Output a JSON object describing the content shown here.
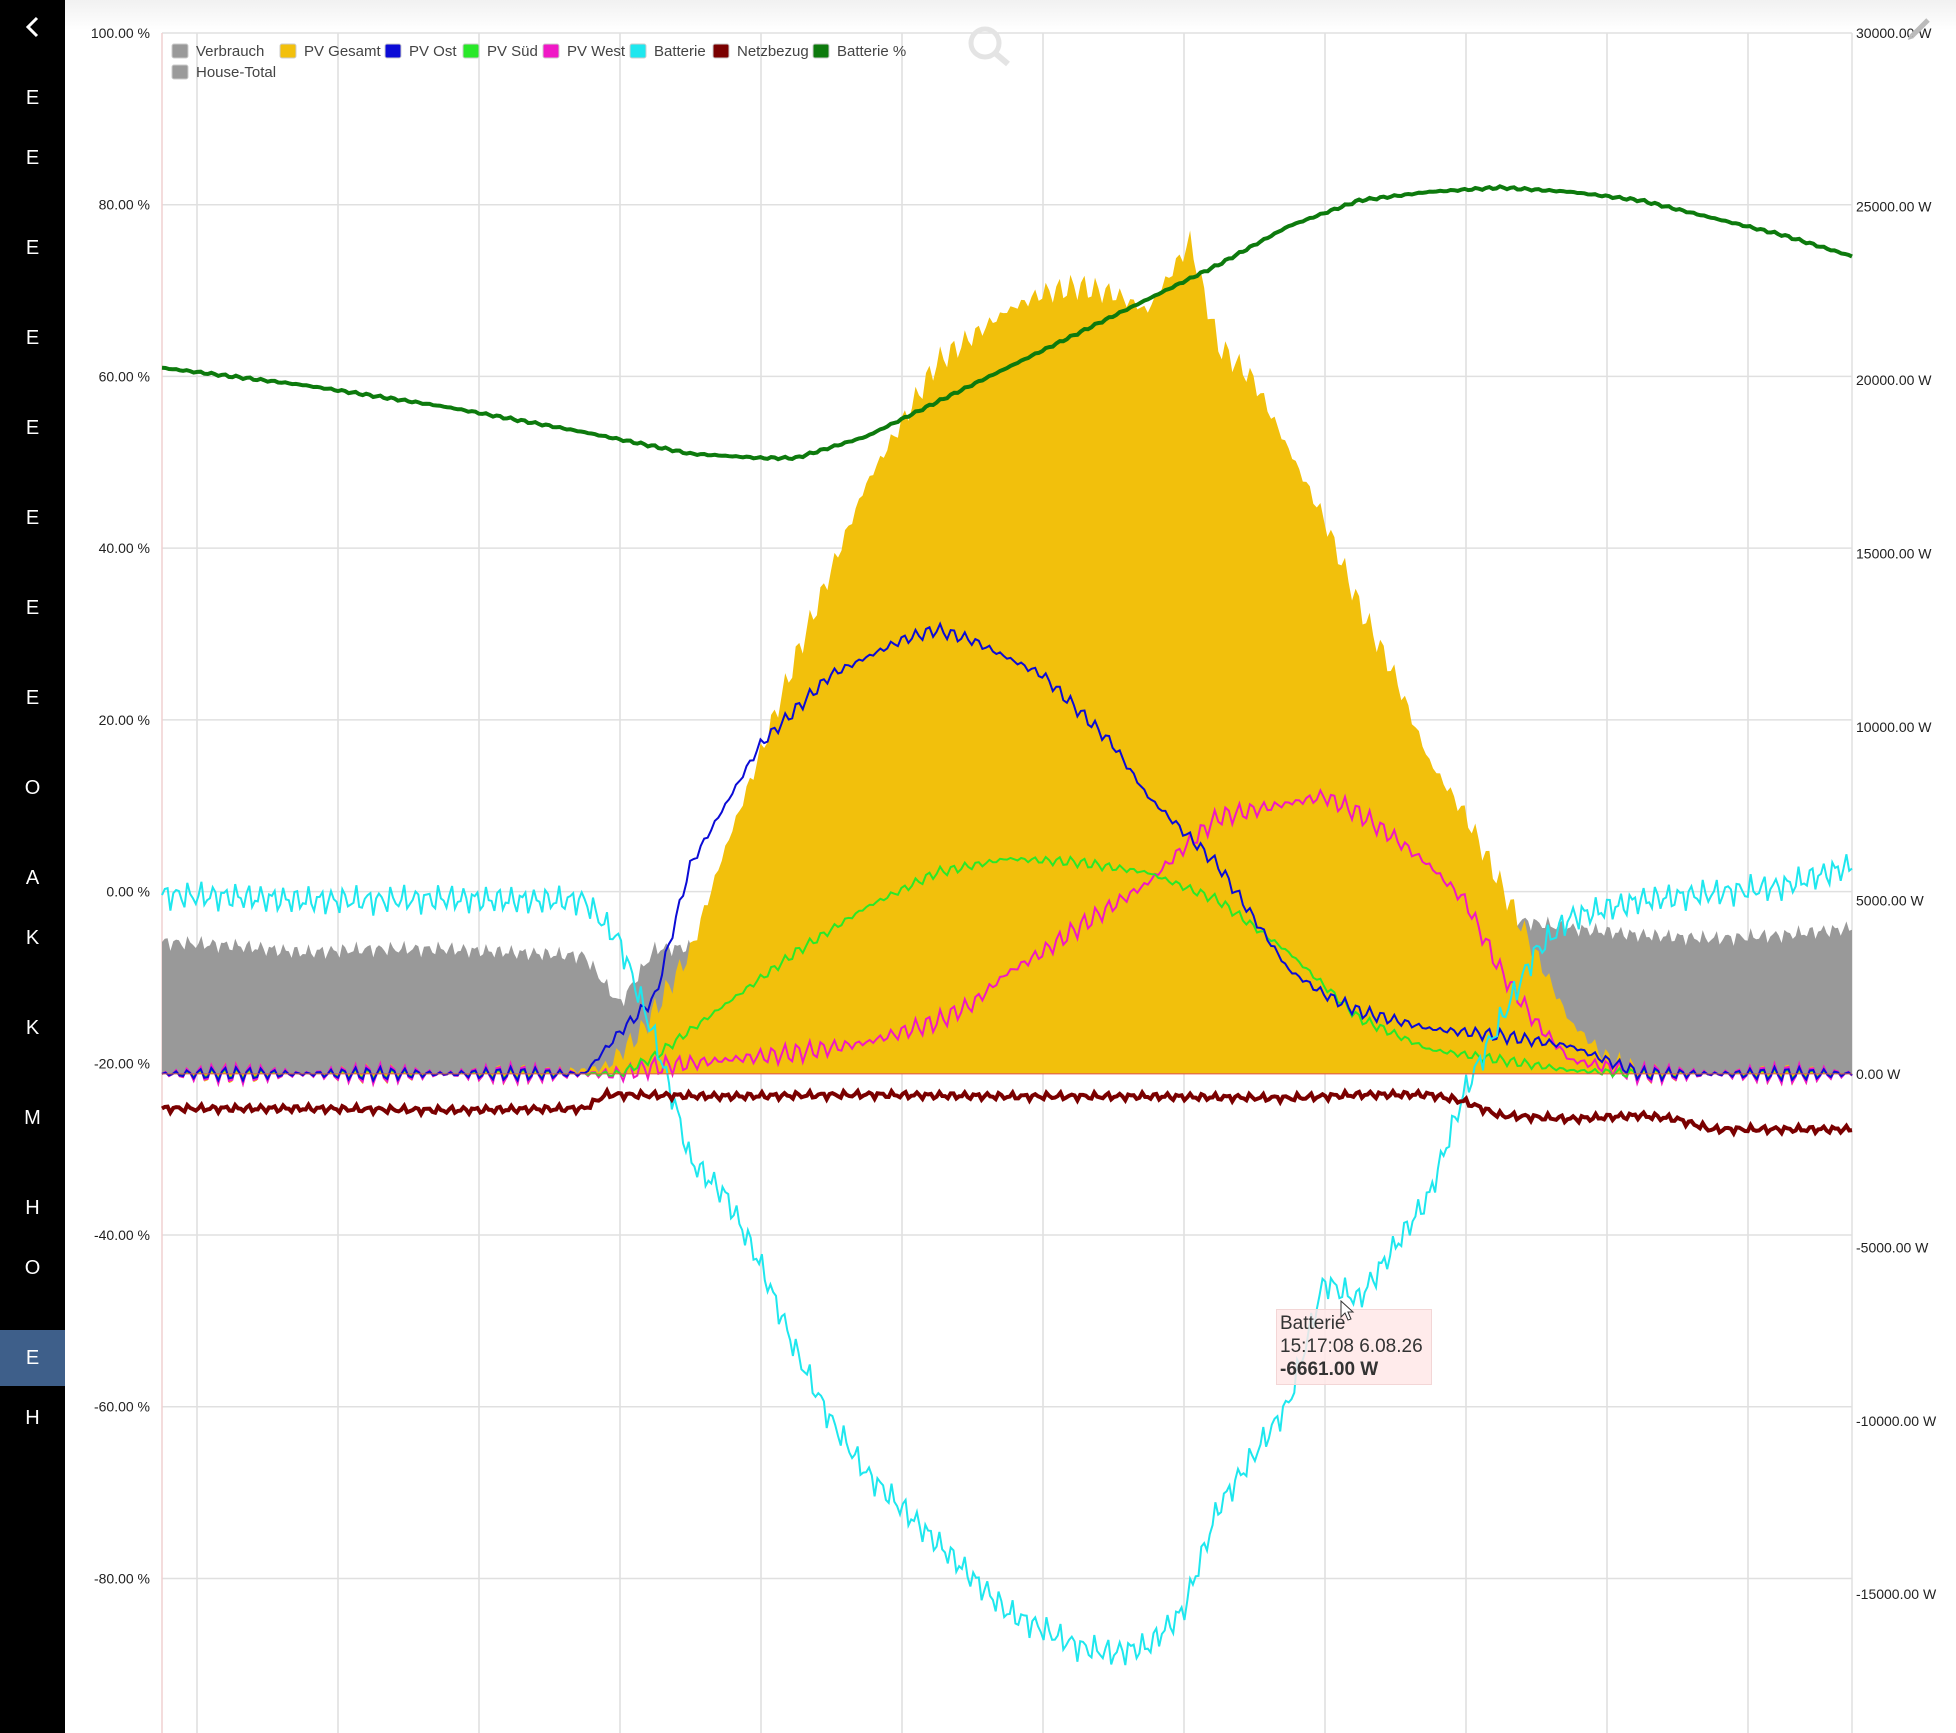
{
  "sidebar": {
    "back_icon": "chevron-left-icon",
    "items": [
      "E",
      "E",
      "E",
      "E",
      "E",
      "E",
      "E",
      "E",
      "O",
      "A",
      "K",
      "K",
      "M",
      "H",
      "O",
      "E",
      "H"
    ],
    "active_index": 15
  },
  "toolbar": {
    "zoom_icon": "magnifier-icon",
    "edit_icon": "pencil-icon"
  },
  "tooltip": {
    "series": "Batterie",
    "time": "15:17:08 6.08.26",
    "value": "-6661.00 W"
  },
  "chart_data": {
    "type": "line",
    "x_range_hours": [
      0,
      24
    ],
    "left_axis": {
      "ticks": [
        "100.00 %",
        "80.00 %",
        "60.00 %",
        "40.00 %",
        "20.00 %",
        "0.00 %",
        "-20.00 %",
        "-40.00 %",
        "-60.00 %",
        "-80.00 %"
      ],
      "range": [
        -98,
        100
      ]
    },
    "right_axis": {
      "ticks": [
        "30000.00 W",
        "25000.00 W",
        "20000.00 W",
        "15000.00 W",
        "10000.00 W",
        "5000.00 W",
        "0.00 W",
        "-5000.00 W",
        "-10000.00 W",
        "-15000.00 W"
      ],
      "range": [
        -19000,
        30000
      ]
    },
    "grid": true,
    "legend_position": "top-left",
    "colors": {
      "verbrauch": "#999999",
      "pv_gesamt": "#f2c00c",
      "pv_ost": "#0b0bd6",
      "pv_sued": "#29e829",
      "pv_west": "#f018c6",
      "batterie": "#1ee7ee",
      "netzbezug": "#7a0000",
      "batterie_pct": "#0d7a0d",
      "house_total": "#9a9a9a"
    },
    "legend": [
      {
        "key": "verbrauch",
        "label": "Verbrauch",
        "color": "#999999"
      },
      {
        "key": "pv_gesamt",
        "label": "PV Gesamt",
        "color": "#f2c00c"
      },
      {
        "key": "pv_ost",
        "label": "PV Ost",
        "color": "#0b0bd6"
      },
      {
        "key": "pv_sued",
        "label": "PV Süd",
        "color": "#29e829"
      },
      {
        "key": "pv_west",
        "label": "PV West",
        "color": "#f018c6"
      },
      {
        "key": "batterie",
        "label": "Batterie",
        "color": "#1ee7ee"
      },
      {
        "key": "netzbezug",
        "label": "Netzbezug",
        "color": "#7a0000"
      },
      {
        "key": "batterie_pct",
        "label": "Batterie %",
        "color": "#0d7a0d"
      },
      {
        "key": "house_total",
        "label": "House-Total",
        "color": "#9a9a9a"
      }
    ],
    "series": [
      {
        "key": "batterie_pct",
        "name": "Batterie %",
        "axis": "left",
        "points": [
          [
            0,
            61
          ],
          [
            2,
            59
          ],
          [
            4,
            56.5
          ],
          [
            6,
            53.5
          ],
          [
            7.5,
            51
          ],
          [
            8.5,
            50.5
          ],
          [
            9,
            50.5
          ],
          [
            10,
            53
          ],
          [
            11,
            57
          ],
          [
            12,
            61
          ],
          [
            13,
            65
          ],
          [
            14,
            69
          ],
          [
            15,
            73
          ],
          [
            16,
            77.5
          ],
          [
            17,
            80.5
          ],
          [
            18,
            81.5
          ],
          [
            19,
            82
          ],
          [
            20,
            81.5
          ],
          [
            21,
            80.5
          ],
          [
            22,
            78.5
          ],
          [
            23,
            76.5
          ],
          [
            24,
            74
          ]
        ]
      },
      {
        "key": "pv_gesamt",
        "name": "PV Gesamt",
        "axis": "right",
        "points": [
          [
            0,
            0
          ],
          [
            5.5,
            0
          ],
          [
            6.3,
            200
          ],
          [
            6.8,
            1200
          ],
          [
            7.5,
            3500
          ],
          [
            8,
            6500
          ],
          [
            9,
            12000
          ],
          [
            10,
            17000
          ],
          [
            11,
            20500
          ],
          [
            12,
            22000
          ],
          [
            12.5,
            22500
          ],
          [
            13,
            22700
          ],
          [
            13.5,
            22500
          ],
          [
            14,
            22000
          ],
          [
            14.3,
            23000
          ],
          [
            14.6,
            24000
          ],
          [
            15,
            21000
          ],
          [
            15.5,
            20000
          ],
          [
            16,
            18000
          ],
          [
            16.5,
            16000
          ],
          [
            17,
            13500
          ],
          [
            17.5,
            11500
          ],
          [
            18,
            9000
          ],
          [
            18.5,
            7500
          ],
          [
            19,
            5500
          ],
          [
            19.5,
            3500
          ],
          [
            20,
            1500
          ],
          [
            20.5,
            500
          ],
          [
            21,
            0
          ],
          [
            24,
            0
          ]
        ]
      },
      {
        "key": "verbrauch",
        "name": "Verbrauch",
        "axis": "right",
        "points": [
          [
            0,
            3800
          ],
          [
            1,
            3700
          ],
          [
            2,
            3500
          ],
          [
            3,
            3600
          ],
          [
            4,
            3600
          ],
          [
            5,
            3500
          ],
          [
            6,
            3400
          ],
          [
            6.5,
            2000
          ],
          [
            7,
            3600
          ],
          [
            8,
            3700
          ],
          [
            9,
            3500
          ],
          [
            10,
            4000
          ],
          [
            10.5,
            5300
          ],
          [
            11,
            4600
          ],
          [
            11.5,
            5000
          ],
          [
            12,
            4800
          ],
          [
            13,
            5000
          ],
          [
            14,
            4800
          ],
          [
            15,
            4700
          ],
          [
            16,
            4200
          ],
          [
            16.5,
            5000
          ],
          [
            17,
            4800
          ],
          [
            18,
            4600
          ],
          [
            19,
            4500
          ],
          [
            20,
            4200
          ],
          [
            21,
            4000
          ],
          [
            22,
            3900
          ],
          [
            23,
            4000
          ],
          [
            24,
            4200
          ]
        ]
      },
      {
        "key": "pv_ost",
        "name": "PV Ost",
        "axis": "right",
        "points": [
          [
            0,
            0
          ],
          [
            6,
            0
          ],
          [
            6.5,
            1200
          ],
          [
            7,
            2200
          ],
          [
            7.5,
            6000
          ],
          [
            8.5,
            9500
          ],
          [
            9.5,
            11500
          ],
          [
            10.5,
            12500
          ],
          [
            11,
            12800
          ],
          [
            11.5,
            12500
          ],
          [
            12,
            12000
          ],
          [
            12.5,
            11500
          ],
          [
            13,
            10500
          ],
          [
            13.5,
            9500
          ],
          [
            14,
            8000
          ],
          [
            14.5,
            7000
          ],
          [
            15,
            6000
          ],
          [
            15.5,
            4500
          ],
          [
            16,
            3000
          ],
          [
            16.5,
            2300
          ],
          [
            17,
            1800
          ],
          [
            18,
            1300
          ],
          [
            19,
            1100
          ],
          [
            20,
            800
          ],
          [
            21,
            0
          ],
          [
            24,
            0
          ]
        ]
      },
      {
        "key": "pv_sued",
        "name": "PV Süd",
        "axis": "right",
        "points": [
          [
            0,
            0
          ],
          [
            6.5,
            0
          ],
          [
            7,
            500
          ],
          [
            8,
            2000
          ],
          [
            9,
            3500
          ],
          [
            10,
            4800
          ],
          [
            11,
            5800
          ],
          [
            12,
            6200
          ],
          [
            13,
            6100
          ],
          [
            14,
            5800
          ],
          [
            15,
            5000
          ],
          [
            16,
            3500
          ],
          [
            17,
            1600
          ],
          [
            18,
            700
          ],
          [
            19,
            400
          ],
          [
            20,
            100
          ],
          [
            21,
            0
          ],
          [
            24,
            0
          ]
        ]
      },
      {
        "key": "pv_west",
        "name": "PV West",
        "axis": "right",
        "points": [
          [
            0,
            0
          ],
          [
            6.5,
            0
          ],
          [
            7,
            200
          ],
          [
            8,
            400
          ],
          [
            9,
            600
          ],
          [
            10,
            900
          ],
          [
            11,
            1500
          ],
          [
            11.5,
            2000
          ],
          [
            12,
            2900
          ],
          [
            12.5,
            3500
          ],
          [
            13,
            4200
          ],
          [
            14,
            5500
          ],
          [
            14.5,
            6500
          ],
          [
            15,
            7400
          ],
          [
            16,
            7800
          ],
          [
            16.5,
            8000
          ],
          [
            17,
            7500
          ],
          [
            17.5,
            6800
          ],
          [
            18,
            6000
          ],
          [
            18.5,
            5000
          ],
          [
            19,
            3000
          ],
          [
            19.5,
            1500
          ],
          [
            20,
            400
          ],
          [
            21,
            0
          ],
          [
            24,
            0
          ]
        ]
      },
      {
        "key": "batterie",
        "name": "Batterie",
        "axis": "right",
        "points": [
          [
            0,
            5150
          ],
          [
            1,
            5100
          ],
          [
            2,
            5000
          ],
          [
            3,
            5000
          ],
          [
            4,
            5050
          ],
          [
            5,
            5000
          ],
          [
            6,
            5000
          ],
          [
            6.5,
            3800
          ],
          [
            7,
            1000
          ],
          [
            7.3,
            -1000
          ],
          [
            7.5,
            -2500
          ],
          [
            8,
            -3500
          ],
          [
            8.5,
            -5500
          ],
          [
            9,
            -8000
          ],
          [
            9.5,
            -10000
          ],
          [
            10,
            -11500
          ],
          [
            10.5,
            -12500
          ],
          [
            11,
            -13500
          ],
          [
            11.5,
            -14500
          ],
          [
            12,
            -15500
          ],
          [
            12.5,
            -16000
          ],
          [
            13,
            -16500
          ],
          [
            13.5,
            -16700
          ],
          [
            14,
            -16500
          ],
          [
            14.5,
            -15500
          ],
          [
            15,
            -12500
          ],
          [
            15.5,
            -11000
          ],
          [
            16,
            -9500
          ],
          [
            16.5,
            -6000
          ],
          [
            17,
            -6500
          ],
          [
            17.5,
            -5000
          ],
          [
            18,
            -3500
          ],
          [
            18.5,
            -500
          ],
          [
            19,
            1500
          ],
          [
            19.5,
            3500
          ],
          [
            20,
            4500
          ],
          [
            21,
            5000
          ],
          [
            22,
            5200
          ],
          [
            23,
            5400
          ],
          [
            24,
            6000
          ]
        ]
      },
      {
        "key": "netzbezug",
        "name": "Netzbezug",
        "axis": "right",
        "points": [
          [
            0,
            -1000
          ],
          [
            2,
            -1000
          ],
          [
            4,
            -1050
          ],
          [
            6,
            -1000
          ],
          [
            6.3,
            -600
          ],
          [
            8,
            -650
          ],
          [
            10,
            -600
          ],
          [
            12,
            -650
          ],
          [
            14,
            -650
          ],
          [
            16,
            -700
          ],
          [
            17,
            -600
          ],
          [
            18,
            -600
          ],
          [
            18.5,
            -800
          ],
          [
            19,
            -1200
          ],
          [
            20,
            -1300
          ],
          [
            21,
            -1200
          ],
          [
            21.5,
            -1300
          ],
          [
            22,
            -1600
          ],
          [
            23,
            -1600
          ],
          [
            24,
            -1600
          ]
        ]
      }
    ]
  }
}
